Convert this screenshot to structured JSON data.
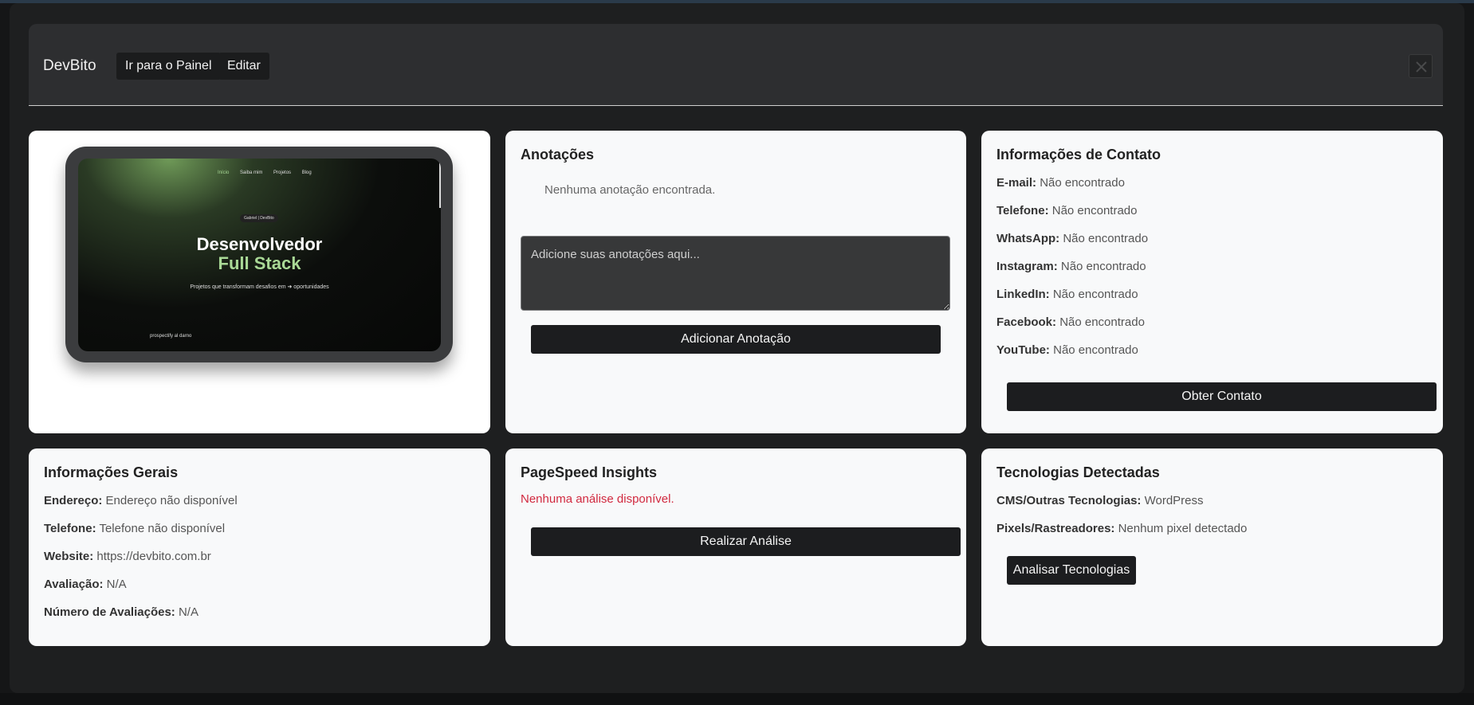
{
  "header": {
    "brand": "DevBito",
    "go_panel_label": "Ir para o Painel",
    "edit_label": "Editar"
  },
  "preview": {
    "nav": [
      "Início",
      "Saiba mim",
      "Projetos",
      "Blog"
    ],
    "badge": "Gabriel | DevBito",
    "headline_1": "Desenvolvedor",
    "headline_2": "Full Stack",
    "subtitle": "Projetos que transformam desafios em ➜ oportunidades",
    "footer": "prospectify al darno"
  },
  "notes": {
    "title": "Anotações",
    "empty": "Nenhuma anotação encontrada.",
    "placeholder": "Adicione suas anotações aqui...",
    "add_label": "Adicionar Anotação"
  },
  "contact": {
    "title": "Informações de Contato",
    "rows": [
      {
        "label": "E-mail:",
        "value": "Não encontrado"
      },
      {
        "label": "Telefone:",
        "value": "Não encontrado"
      },
      {
        "label": "WhatsApp:",
        "value": "Não encontrado"
      },
      {
        "label": "Instagram:",
        "value": "Não encontrado"
      },
      {
        "label": "LinkedIn:",
        "value": "Não encontrado"
      },
      {
        "label": "Facebook:",
        "value": "Não encontrado"
      },
      {
        "label": "YouTube:",
        "value": "Não encontrado"
      }
    ],
    "button_label": "Obter Contato"
  },
  "general": {
    "title": "Informações Gerais",
    "rows": [
      {
        "label": "Endereço:",
        "value": "Endereço não disponível"
      },
      {
        "label": "Telefone:",
        "value": "Telefone não disponível"
      },
      {
        "label": "Website:",
        "value": "https://devbito.com.br"
      },
      {
        "label": "Avaliação:",
        "value": "N/A"
      },
      {
        "label": "Número de Avaliações:",
        "value": "N/A"
      }
    ]
  },
  "pagespeed": {
    "title": "PageSpeed Insights",
    "empty": "Nenhuma análise disponível.",
    "button_label": "Realizar Análise"
  },
  "tech": {
    "title": "Tecnologias Detectadas",
    "rows": [
      {
        "label": "CMS/Outras Tecnologias:",
        "value": "WordPress"
      },
      {
        "label": "Pixels/Rastreadores:",
        "value": "Nenhum pixel detectado"
      }
    ],
    "button_label": "Analisar Tecnologias"
  },
  "colors": {
    "backdrop": "#151617",
    "modal": "#1e1f20",
    "card": "#f8f9fa",
    "button": "#1c1d1f",
    "error": "#d1293f",
    "accent_green": "#a9d996"
  }
}
